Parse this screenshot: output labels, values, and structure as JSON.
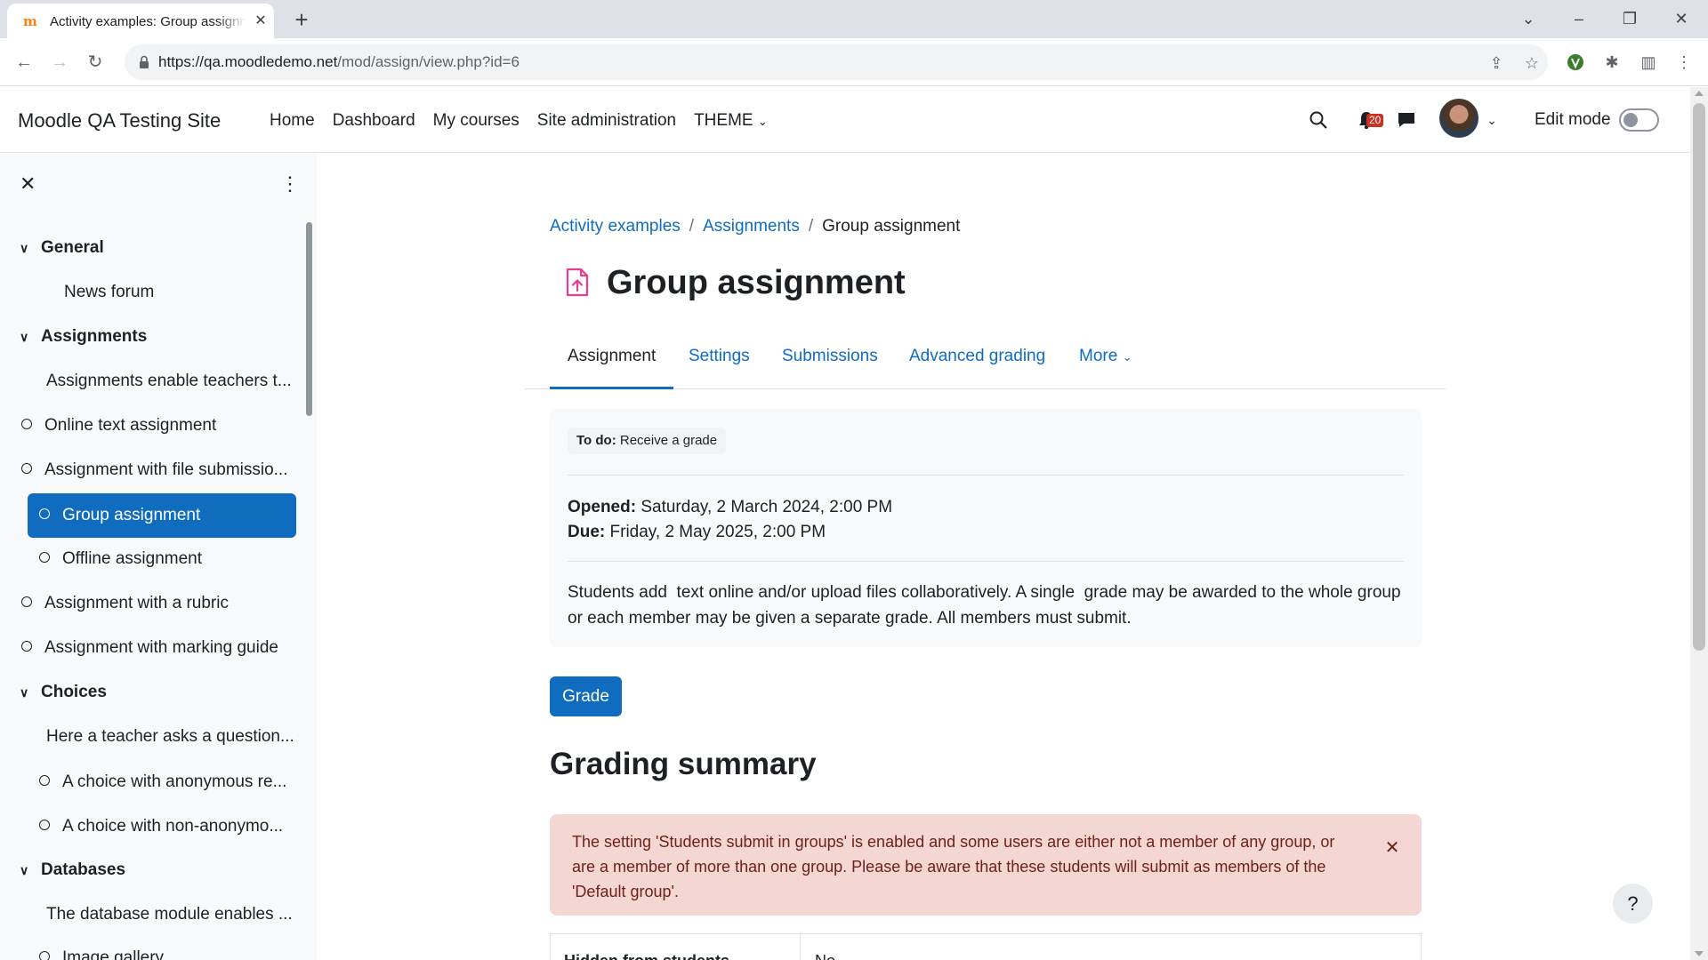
{
  "browser": {
    "tab_title": "Activity examples: Group assignment",
    "url_host": "https://qa.moodledemo.net",
    "url_path": "/mod/assign/view.php?id=6"
  },
  "header": {
    "site_name": "Moodle QA Testing Site",
    "nav": [
      "Home",
      "Dashboard",
      "My courses",
      "Site administration",
      "THEME"
    ],
    "notification_count": "20",
    "edit_mode_label": "Edit mode"
  },
  "course_index": {
    "items": [
      {
        "label": "General",
        "kind": "section"
      },
      {
        "label": "News forum",
        "kind": "module"
      },
      {
        "label": "Assignments",
        "kind": "section"
      },
      {
        "label": "Assignments enable teachers t...",
        "kind": "label"
      },
      {
        "label": "Online text assignment",
        "kind": "activity"
      },
      {
        "label": "Assignment with file submissio...",
        "kind": "activity"
      },
      {
        "label": "Group assignment",
        "kind": "activity-active"
      },
      {
        "label": "Offline assignment",
        "kind": "activity-nested"
      },
      {
        "label": "Assignment with a rubric",
        "kind": "activity"
      },
      {
        "label": "Assignment with marking guide",
        "kind": "activity"
      },
      {
        "label": "Choices",
        "kind": "section"
      },
      {
        "label": "Here a teacher asks a question...",
        "kind": "label"
      },
      {
        "label": "A choice with anonymous re...",
        "kind": "activity-nested"
      },
      {
        "label": "A choice with non-anonymo...",
        "kind": "activity-nested"
      },
      {
        "label": "Databases",
        "kind": "section"
      },
      {
        "label": "The database module enables ...",
        "kind": "label"
      },
      {
        "label": "Image gallery",
        "kind": "activity-nested"
      }
    ]
  },
  "breadcrumb": {
    "items": [
      "Activity examples",
      "Assignments"
    ],
    "current": "Group assignment"
  },
  "page": {
    "title": "Group assignment"
  },
  "secondary_nav": {
    "tabs": [
      "Assignment",
      "Settings",
      "Submissions",
      "Advanced grading",
      "More"
    ],
    "active": "Assignment"
  },
  "activity": {
    "todo_label": "To do:",
    "todo_text": "Receive a grade",
    "opened_label": "Opened:",
    "opened_value": "Saturday, 2 March 2024, 2:00 PM",
    "due_label": "Due:",
    "due_value": "Friday, 2 May 2025, 2:00 PM",
    "intro": "Students add  text online and/or upload files collaboratively. A single  grade may be awarded to the whole group or each member may be given a separate grade. All members must submit."
  },
  "grade_button": "Grade",
  "grading_summary": {
    "heading": "Grading summary",
    "alert": "The setting 'Students submit in groups' is enabled and some users are either not a member of any group, or are a member of more than one group. Please be aware that these students will submit as members of the 'Default group'.",
    "rows": [
      {
        "label": "Hidden from students",
        "value": "No"
      }
    ]
  },
  "help_label": "?",
  "colors": {
    "brand": "#0f6cbf",
    "alert_bg": "#f4d6d2",
    "alert_text": "#6e211a",
    "badge": "#ca3120",
    "activity_icon": "#e83e8c"
  }
}
